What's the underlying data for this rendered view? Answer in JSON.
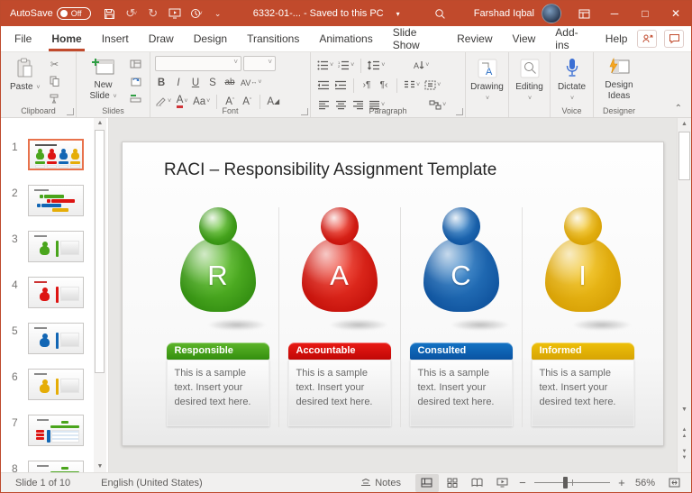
{
  "accent_color": "#c14a2c",
  "titlebar": {
    "autosave_label": "AutoSave",
    "autosave_state": "Off",
    "document_title": "6332-01-...  -  Saved to this PC",
    "user_name": "Farshad Iqbal"
  },
  "tabs": {
    "active": "Home",
    "items": [
      "File",
      "Home",
      "Insert",
      "Draw",
      "Design",
      "Transitions",
      "Animations",
      "Slide Show",
      "Review",
      "View",
      "Add-ins",
      "Help"
    ]
  },
  "ribbon": {
    "paste_label": "Paste",
    "new_slide_label": "New Slide",
    "drawing_label": "Drawing",
    "editing_label": "Editing",
    "dictate_label": "Dictate",
    "design_ideas_label": "Design Ideas",
    "groups": {
      "clipboard": "Clipboard",
      "slides": "Slides",
      "font": "Font",
      "paragraph": "Paragraph",
      "voice": "Voice",
      "designer": "Designer"
    },
    "font": {
      "bold": "B",
      "italic": "I",
      "underline": "U",
      "strike": "S",
      "strike2": "ab",
      "spacing": "AV",
      "case": "Aa",
      "grow": "A",
      "shrink": "A",
      "clear": "A",
      "color": "A"
    }
  },
  "thumbnails": [
    {
      "num": "1",
      "type": "raci4",
      "selected": true
    },
    {
      "num": "2",
      "type": "bars"
    },
    {
      "num": "3",
      "type": "figure-green"
    },
    {
      "num": "4",
      "type": "figure-red"
    },
    {
      "num": "5",
      "type": "figure-blue"
    },
    {
      "num": "6",
      "type": "figure-yellow"
    },
    {
      "num": "7",
      "type": "table"
    },
    {
      "num": "8",
      "type": "table"
    }
  ],
  "slide": {
    "title": "RACI – Responsibility Assignment Template",
    "columns": [
      {
        "letter": "R",
        "label": "Responsible",
        "fig_light": "#63c430",
        "fig_dark": "#2b850c",
        "banner_light": "#5db52a",
        "banner_dark": "#338f0e",
        "body": "This is a sample text. Insert your desired text here."
      },
      {
        "letter": "A",
        "label": "Accountable",
        "fig_light": "#f23c2c",
        "fig_dark": "#bd0a05",
        "banner_light": "#ea1a14",
        "banner_dark": "#c00806",
        "body": "This is a sample text. Insert your desired text here."
      },
      {
        "letter": "C",
        "label": "Consulted",
        "fig_light": "#3180c7",
        "fig_dark": "#0a4c97",
        "banner_light": "#1373c4",
        "banner_dark": "#0a53a2",
        "body": "This is a sample text. Insert your desired text here."
      },
      {
        "letter": "I",
        "label": "Informed",
        "fig_light": "#f4c522",
        "fig_dark": "#d29a00",
        "banner_light": "#eec009",
        "banner_dark": "#d7a403",
        "body": "This is a sample text. Insert your desired text here."
      }
    ]
  },
  "statusbar": {
    "slide_indicator": "Slide 1 of 10",
    "language": "English (United States)",
    "notes_label": "Notes",
    "zoom_level": "56%"
  }
}
